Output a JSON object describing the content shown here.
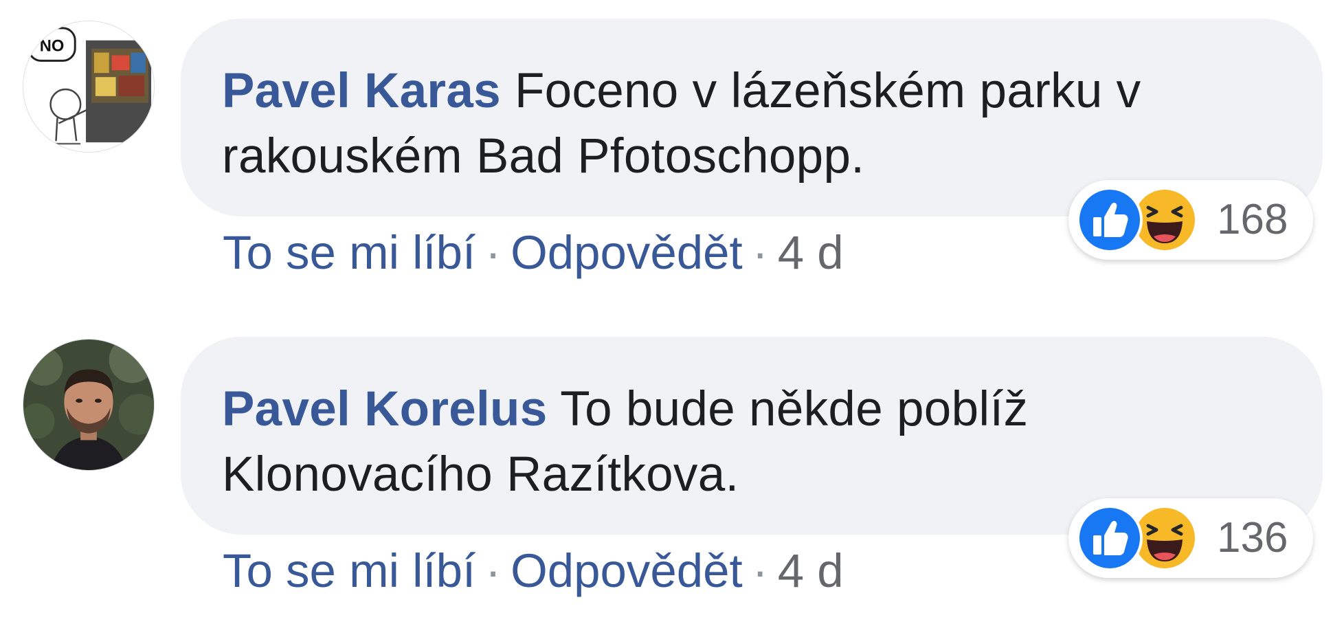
{
  "comments": [
    {
      "author": "Pavel Karas",
      "text": "Foceno v lázeňském parku v rakouském Bad Pfotoschopp.",
      "like_label": "To se mi líbí",
      "reply_label": "Odpovědět",
      "separator": "·",
      "time": "4 d",
      "reaction_count": "168",
      "reaction_icons": [
        "like-icon",
        "haha-icon"
      ],
      "avatar_text": "NO"
    },
    {
      "author": "Pavel Korelus",
      "text": "To bude někde poblíž Klonovacího Razítkova.",
      "like_label": "To se mi líbí",
      "reply_label": "Odpovědět",
      "separator": "·",
      "time": "4 d",
      "reaction_count": "136",
      "reaction_icons": [
        "like-icon",
        "haha-icon"
      ]
    }
  ],
  "colors": {
    "author": "#385898",
    "link": "#385898",
    "bubble_bg": "#f0f2f5",
    "text": "#1c1e21",
    "meta": "#65676b",
    "like_blue": "#1877f2",
    "haha_yellow": "#f7b928"
  }
}
